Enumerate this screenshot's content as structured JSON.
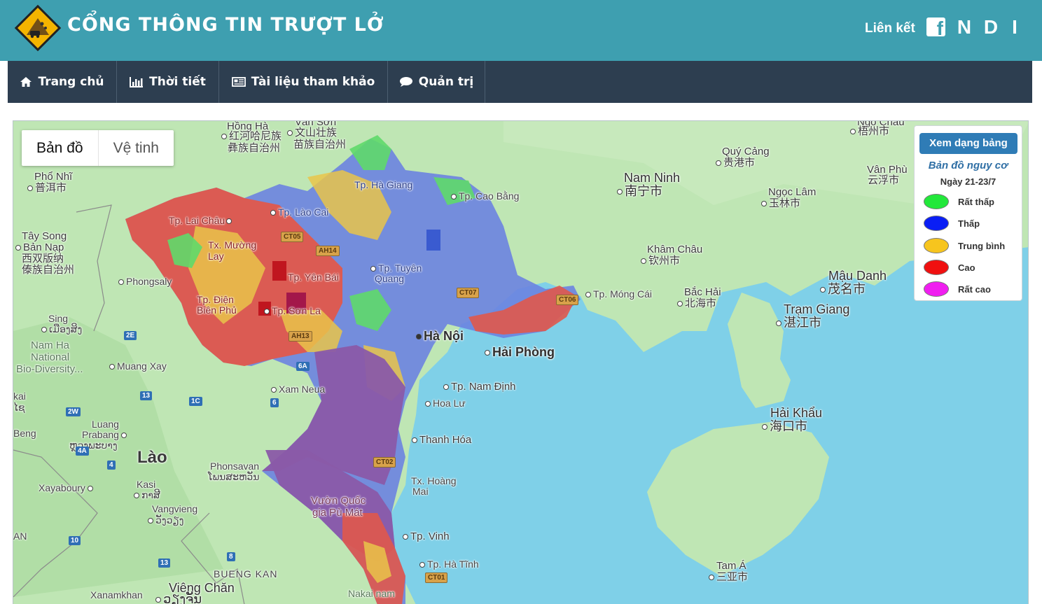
{
  "header": {
    "title": "CỔNG THÔNG TIN TRƯỢT LỞ",
    "links_label": "Liên kết",
    "social": [
      {
        "icon": "facebook-icon",
        "text": "f"
      },
      {
        "icon": "n-link-icon",
        "text": "N"
      },
      {
        "icon": "d-link-icon",
        "text": "D"
      },
      {
        "icon": "i-link-icon",
        "text": "I"
      }
    ]
  },
  "nav": {
    "items": [
      {
        "label": "Trang chủ",
        "icon": "home-icon"
      },
      {
        "label": "Thời tiết",
        "icon": "bar-chart-icon"
      },
      {
        "label": "Tài liệu tham khảo",
        "icon": "newspaper-icon"
      },
      {
        "label": "Quản trị",
        "icon": "comment-icon"
      }
    ]
  },
  "map": {
    "type_control": {
      "map": "Bản đồ",
      "satellite": "Vệ tinh"
    },
    "places": {
      "hong_ha": "Hồng Hà",
      "hong_ha_cn": "红河哈尼族",
      "hong_ha_cn2": "彝族自治州",
      "van_son": "Văn Sơn",
      "van_son_cn": "文山壮族",
      "van_son_cn2": "苗族自治州",
      "pho_nhi": "Phổ Nhĩ",
      "pho_nhi_cn": "普洱市",
      "tay_song": "Tây Song",
      "ban_nap": "Bản Nạp",
      "tay_song_cn": "西双版纳",
      "tay_song_cn2": "傣族自治州",
      "phongsaly": "Phongsaly",
      "sing": "Sing",
      "sing_lo": "ເມືອງສິງ",
      "nam_ha": "Nam Ha",
      "national": "National",
      "biodiv": "Bio-Diversity...",
      "muang_xay": "Muang Xay",
      "xam_neua": "Xam Neua",
      "kai": "kai",
      "kai_lo": "ໄຊ",
      "luang": "Luang",
      "prabang": "Prabang",
      "prabang_lo": "ຫຼວງພະບາງ",
      "beng": "Beng",
      "lao": "Lào",
      "phonsavan": "Phonsavan",
      "phonsavan_lo": "ໂພນສະຫວັນ",
      "xayaboury": "Xayaboury",
      "kasi": "Kasi",
      "kasi_lo": "ກາສີ",
      "vangvieng": "Vangvieng",
      "vangvieng_lo": "ວັງວຽງ",
      "an": "AN",
      "bueng_kan": "BUENG KAN",
      "vieng_chan": "Viêng Chăn",
      "vieng_chan_lo": "ວຽງຈັນ",
      "xanamkhan": "Xanamkhan",
      "nakai": "Nakai nam",
      "lai_chau": "Tp. Lai Châu",
      "muong_lay": "Tx. Mường",
      "muong_lay2": "Lay",
      "dien_bien": "Tp. Điện",
      "dien_bien2": "Biên Phủ",
      "son_la": "Tp. Sơn La",
      "lao_cai": "Tp. Lào Cai",
      "yen_bai": "Tp. Yên Bái",
      "ha_giang": "Tp. Hà Giang",
      "cao_bang": "Tp. Cao Bằng",
      "tuyen_quang": "Tp. Tuyên",
      "tuyen_quang2": "Quang",
      "ha_noi": "Hà Nội",
      "hai_phong": "Hải Phòng",
      "nam_dinh": "Tp. Nam Định",
      "hoa_lu": "Hoa Lư",
      "thanh_hoa": "Thanh Hóa",
      "hoang_mai": "Tx. Hoàng",
      "hoang_mai2": "Mai",
      "pu_mat": "Vườn Quốc",
      "pu_mat2": "gia Pù Mát",
      "vinh": "Tp. Vinh",
      "ha_tinh": "Tp. Hà Tĩnh",
      "mong_cai": "Tp. Móng Cái",
      "nam_ninh": "Nam Ninh",
      "nam_ninh_cn": "南宁市",
      "quy_cang": "Quý Cảng",
      "quy_cang_cn": "贵港市",
      "ngoc_lam": "Ngọc Lâm",
      "ngoc_lam_cn": "玉林市",
      "van_phu": "Vân Phù",
      "van_phu_cn": "云浮市",
      "ngo_chau": "Ngô Châu",
      "ngo_chau_cn": "梧州市",
      "kham_chau": "Khâm Châu",
      "kham_chau_cn": "钦州市",
      "bac_hai": "Bắc Hải",
      "bac_hai_cn": "北海市",
      "mau_danh": "Mậu Danh",
      "mau_danh_cn": "茂名市",
      "tram_giang": "Trạm Giang",
      "tram_giang_cn": "湛江市",
      "hai_khau": "Hải Khẩu",
      "hai_khau_cn": "海口市",
      "tam_a": "Tam Á",
      "tam_a_cn": "三亚市"
    },
    "road_shields": [
      "CT05",
      "AH14",
      "CT07",
      "CT06",
      "AH13",
      "CT02",
      "CT01",
      "2E",
      "6A",
      "13",
      "1C",
      "6",
      "2W",
      "4A",
      "4",
      "10",
      "13",
      "8"
    ]
  },
  "legend": {
    "table_button": "Xem dạng bảng",
    "title": "Bản đồ nguy cơ",
    "date": "Ngày 21-23/7",
    "items": [
      {
        "label": "Rất thấp",
        "color": "#22e83a"
      },
      {
        "label": "Thấp",
        "color": "#0a1ef5"
      },
      {
        "label": "Trung bình",
        "color": "#f7c51e"
      },
      {
        "label": "Cao",
        "color": "#f01010"
      },
      {
        "label": "Rất cao",
        "color": "#f01ef0"
      }
    ]
  },
  "colors": {
    "header_bg": "#3e9fb0",
    "nav_bg": "#2d3e50",
    "sea": "#7fd0e8",
    "land": "#bfe6b4"
  }
}
